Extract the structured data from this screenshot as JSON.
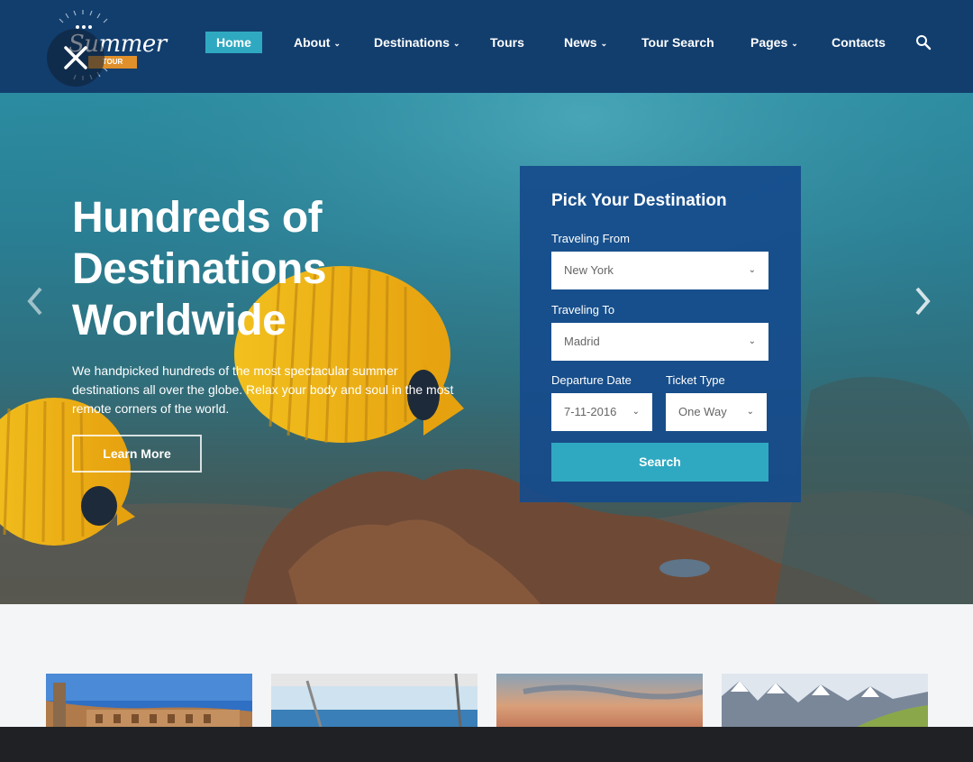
{
  "header": {
    "logo_text": "Summer",
    "logo_ribbon": "TOUR",
    "nav": [
      {
        "label": "Home",
        "active": true,
        "dropdown": false
      },
      {
        "label": "About",
        "dropdown": true
      },
      {
        "label": "Destinations",
        "dropdown": true
      },
      {
        "label": "Tours",
        "dropdown": false
      },
      {
        "label": "News",
        "dropdown": true
      },
      {
        "label": "Tour Search",
        "dropdown": false
      },
      {
        "label": "Pages",
        "dropdown": true
      },
      {
        "label": "Contacts",
        "dropdown": false
      }
    ],
    "icons": {
      "search": "search-icon",
      "close": "close-icon"
    }
  },
  "hero": {
    "title_lines": [
      "Hundreds of",
      "Destinations",
      "Worldwide"
    ],
    "description": "We handpicked hundreds of the most spectacular summer destinations all over the globe. Relax your body and soul in the most remote corners of the world.",
    "cta": "Learn More"
  },
  "booking": {
    "title": "Pick Your Destination",
    "from_label": "Traveling From",
    "from_value": "New York",
    "to_label": "Traveling To",
    "to_value": "Madrid",
    "date_label": "Departure Date",
    "date_value": "7-11-2016",
    "ticket_label": "Ticket Type",
    "ticket_value": "One Way",
    "search_label": "Search"
  },
  "colors": {
    "header_bg": "#123e6e",
    "accent": "#2fa9c1",
    "form_bg": "#154b8c"
  }
}
